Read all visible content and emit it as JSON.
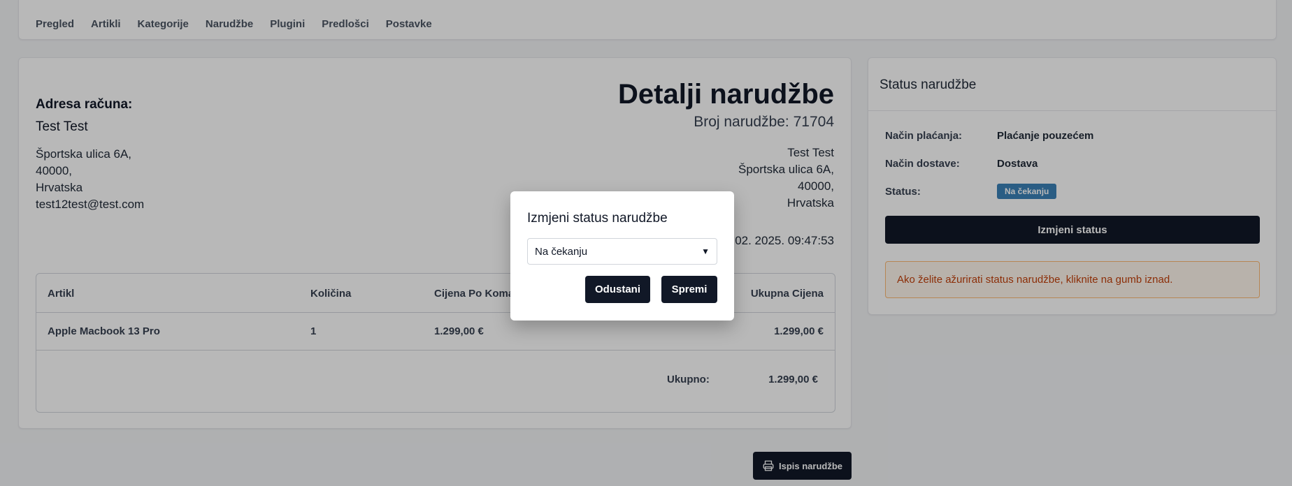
{
  "nav": {
    "items": [
      "Pregled",
      "Artikli",
      "Kategorije",
      "Narudžbe",
      "Plugini",
      "Predlošci",
      "Postavke"
    ]
  },
  "order": {
    "billing_heading": "Adresa računa:",
    "billing_name": "Test Test",
    "billing_street": "Športska ulica 6A,",
    "billing_zip": "40000,",
    "billing_country": "Hrvatska",
    "billing_email": "test12test@test.com",
    "title": "Detalji narudžbe",
    "number_text": "Broj narudžbe: 71704",
    "ship_name": "Test Test",
    "ship_street": "Športska ulica 6A,",
    "ship_zip": "40000,",
    "ship_country": "Hrvatska",
    "date_text": "02. 2025. 09:47:53"
  },
  "table": {
    "headers": [
      "Artikl",
      "Količina",
      "Cijena Po Komad",
      "Ukupna Cijena"
    ],
    "rows": [
      {
        "item": "Apple Macbook 13 Pro",
        "qty": "1",
        "unit_price": "1.299,00 €",
        "total": "1.299,00 €"
      }
    ],
    "total_label": "Ukupno:",
    "total_value": "1.299,00 €"
  },
  "status_card": {
    "title": "Status narudžbe",
    "payment_label": "Način plaćanja:",
    "payment_value": "Plaćanje pouzećem",
    "delivery_label": "Način dostave:",
    "delivery_value": "Dostava",
    "status_label": "Status:",
    "status_badge": "Na čekanju",
    "change_button": "Izmjeni status",
    "alert_text": "Ako želite ažurirati status narudžbe, kliknite na gumb iznad.",
    "badge_color": "#3b82b8"
  },
  "print_button": "Ispis narudžbe",
  "modal": {
    "title": "Izmjeni status narudžbe",
    "selected": "Na čekanju",
    "cancel": "Odustani",
    "save": "Spremi"
  }
}
